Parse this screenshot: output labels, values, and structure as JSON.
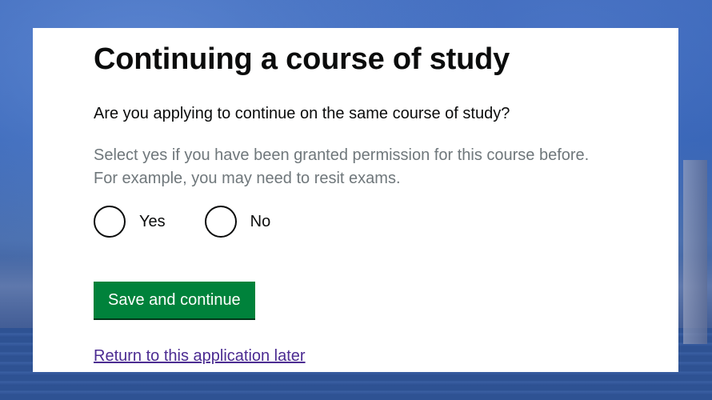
{
  "page": {
    "title": "Continuing a course of study",
    "question": "Are you applying to continue on the same course of study?",
    "hint_line1": "Select yes if you have been granted permission for this course before.",
    "hint_line2": "For example, you may need to resit exams."
  },
  "radios": [
    {
      "label": "Yes",
      "selected": false
    },
    {
      "label": "No",
      "selected": false
    }
  ],
  "actions": {
    "primary_button": "Save and continue",
    "return_link": "Return to this application later"
  },
  "colors": {
    "button_green": "#00823b",
    "link_purple": "#4c2c92",
    "hint_grey": "#6f777b",
    "text_black": "#0b0c0c",
    "background_blue": "#2a4f9c"
  }
}
